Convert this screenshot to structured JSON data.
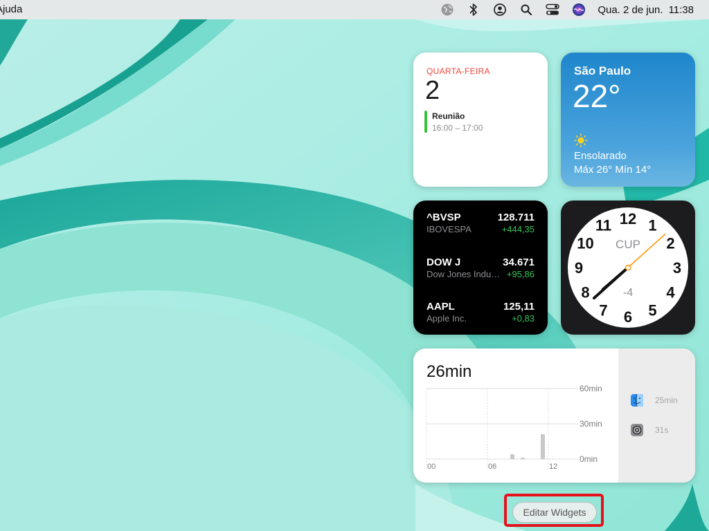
{
  "menubar": {
    "app_menu": "Ajuda",
    "date": "Qua. 2 de jun.",
    "time": "11:38",
    "icons": [
      "globe-icon",
      "bluetooth-icon",
      "user-account-icon",
      "search-icon",
      "control-center-icon",
      "siri-icon"
    ]
  },
  "calendar": {
    "weekday": "QUARTA-FEIRA",
    "day": "2",
    "event_title": "Reunião",
    "event_time": "16:00 – 17:00",
    "event_color": "#37c23c",
    "accent_color": "#f0443a"
  },
  "weather": {
    "city": "São Paulo",
    "temperature": "22°",
    "condition": "Ensolarado",
    "range": "Máx 26° Mín 14°",
    "icon": "sun-icon"
  },
  "stocks": [
    {
      "symbol": "^BVSP",
      "name": "IBOVESPA",
      "price": "128.711",
      "change": "+444,35"
    },
    {
      "symbol": "DOW J",
      "name": "Dow Jones Industrial Average",
      "price": "34.671",
      "change": "+95,86"
    },
    {
      "symbol": "AAPL",
      "name": "Apple Inc.",
      "price": "125,11",
      "change": "+0,83"
    }
  ],
  "clock": {
    "city_code": "CUP",
    "offset": "-4",
    "numbers": [
      "12",
      "1",
      "2",
      "3",
      "4",
      "5",
      "6",
      "7",
      "8",
      "9",
      "10",
      "11"
    ],
    "hour": 7,
    "minute": 38
  },
  "screen_time": {
    "total": "26min",
    "y_ticks": [
      "60min",
      "30min",
      "0min"
    ],
    "x_ticks": [
      "00",
      "06",
      "12"
    ],
    "apps": [
      {
        "icon": "finder-icon",
        "time": "25min"
      },
      {
        "icon": "system-preferences-icon",
        "time": "31s"
      }
    ]
  },
  "edit_widgets_label": "Editar Widgets"
}
